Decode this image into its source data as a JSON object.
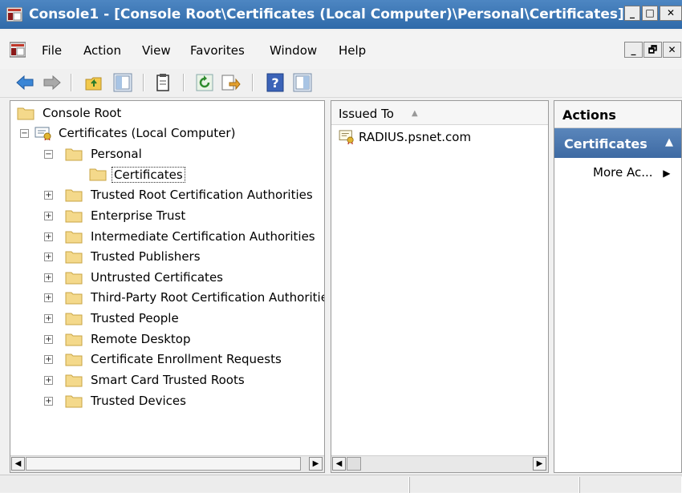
{
  "window": {
    "title": "Console1 - [Console Root\\Certificates (Local Computer)\\Personal\\Certificates]",
    "minimize": "_",
    "maximize": "□",
    "close": "✕"
  },
  "menu": {
    "items": [
      "File",
      "Action",
      "View",
      "Favorites",
      "Window",
      "Help"
    ],
    "mdi_minimize": "_",
    "mdi_restore": "🗗",
    "mdi_close": "✕"
  },
  "toolbar": {
    "buttons": [
      "back-icon",
      "forward-icon",
      "up-folder-icon",
      "show-hide-tree-icon",
      "copy-icon",
      "refresh-icon",
      "export-list-icon",
      "help-icon",
      "show-hide-action-pane-icon"
    ]
  },
  "tree": {
    "root": "Console Root",
    "certificates": "Certificates (Local Computer)",
    "personal": "Personal",
    "personal_certificates": "Certificates",
    "stores": [
      "Trusted Root Certification Authorities",
      "Enterprise Trust",
      "Intermediate Certification Authorities",
      "Trusted Publishers",
      "Untrusted Certificates",
      "Third-Party Root Certification Authorities",
      "Trusted People",
      "Remote Desktop",
      "Certificate Enrollment Requests",
      "Smart Card Trusted Roots",
      "Trusted Devices"
    ],
    "expand_symbol": "+",
    "collapse_symbol": "−"
  },
  "list": {
    "column_header": "Issued To",
    "sort_indicator": "▲",
    "rows": [
      "RADIUS.psnet.com"
    ]
  },
  "actions": {
    "header": "Actions",
    "section_title": "Certificates",
    "section_arrow": "▲",
    "more_actions": "More Ac...",
    "more_arrow": "▶"
  },
  "colors": {
    "titlebar": "#2f6aa9",
    "actions_section": "#3e6aa3",
    "folder": "#f4d98b"
  }
}
